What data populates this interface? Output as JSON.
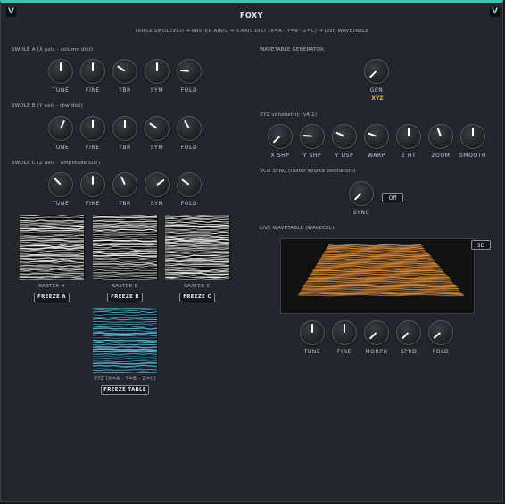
{
  "app": {
    "title": "FOXY",
    "subtitle": "TRIPLE SWOLEVCO → RASTER A/B/C → 3-AXIS DIST (X=A · Y=B · Z=C) → LIVE WAVETABLE",
    "screw_glyph": "V"
  },
  "swole_a": {
    "title": "SWOLE A (X axis · column dist)",
    "knobs": [
      {
        "label": "TUNE",
        "angle": 0
      },
      {
        "label": "FINE",
        "angle": 0
      },
      {
        "label": "TBR",
        "angle": -55
      },
      {
        "label": "SYM",
        "angle": 0
      },
      {
        "label": "FOLD",
        "angle": -85
      }
    ]
  },
  "swole_b": {
    "title": "SWOLE B (Y axis · row dist)",
    "knobs": [
      {
        "label": "TUNE",
        "angle": 25
      },
      {
        "label": "FINE",
        "angle": 0
      },
      {
        "label": "TBR",
        "angle": 0
      },
      {
        "label": "SYM",
        "angle": -55
      },
      {
        "label": "FOLD",
        "angle": -30
      }
    ]
  },
  "swole_c": {
    "title": "SWOLE C (Z axis · amplitude LUT)",
    "knobs": [
      {
        "label": "TUNE",
        "angle": -45
      },
      {
        "label": "FINE",
        "angle": 0
      },
      {
        "label": "TBR",
        "angle": -25
      },
      {
        "label": "SYM",
        "angle": 55
      },
      {
        "label": "FOLD",
        "angle": -55
      }
    ]
  },
  "rasters": [
    {
      "caption": "RASTER A",
      "button": "FREEZE A"
    },
    {
      "caption": "RASTER B",
      "button": "FREEZE B"
    },
    {
      "caption": "RASTER C",
      "button": "FREEZE C"
    }
  ],
  "xyz_table": {
    "caption": "XYZ (X=A · Y=B · Z=C)",
    "button": "FREEZE TABLE"
  },
  "wavetable_gen": {
    "title": "WAVETABLE GENERATOR",
    "knob": {
      "label": "GEN",
      "angle": -135
    },
    "value": "XYZ"
  },
  "xyz_volumetric": {
    "title": "XYZ volumetric (v4.1)",
    "knobs": [
      {
        "label": "X SHP",
        "angle": -135
      },
      {
        "label": "Y SHP",
        "angle": -85
      },
      {
        "label": "Y DSP",
        "angle": -65
      },
      {
        "label": "WARP",
        "angle": -70
      },
      {
        "label": "Z HT",
        "angle": 0
      },
      {
        "label": "ZOOM",
        "angle": -20
      },
      {
        "label": "SMOOTH",
        "angle": 0
      }
    ]
  },
  "vco_sync": {
    "title": "VCO SYNC (raster source oscillators)",
    "knob": {
      "label": "SYNC",
      "angle": -135
    },
    "toggle": "Off"
  },
  "live_wavetable": {
    "title": "LIVE WAVETABLE (WAVECEL)",
    "mode_button": "3D",
    "knobs": [
      {
        "label": "TUNE",
        "angle": 0
      },
      {
        "label": "FINE",
        "angle": 0
      },
      {
        "label": "MORPH",
        "angle": -135
      },
      {
        "label": "SPRD",
        "angle": -135
      },
      {
        "label": "FOLD",
        "angle": -130
      }
    ]
  },
  "colors": {
    "accent": "#38c9b5",
    "gen_value": "#e6b23f",
    "wave": "#d9883a"
  }
}
